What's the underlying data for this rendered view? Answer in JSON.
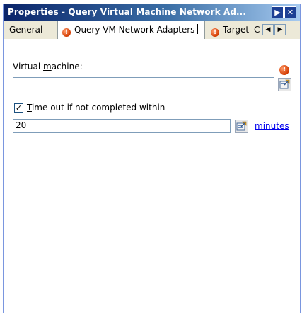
{
  "window": {
    "title": "Properties - Query Virtual Machine Network Ad..."
  },
  "titlebar_buttons": {
    "menu_glyph": "▶",
    "close_glyph": "✕"
  },
  "tabs": [
    {
      "label": "General",
      "active": false,
      "has_error": false
    },
    {
      "label": "Query VM Network Adapters",
      "active": true,
      "has_error": true
    },
    {
      "label": "Target",
      "active": false,
      "has_error": true
    },
    {
      "label": "C",
      "active": false,
      "has_error": false
    }
  ],
  "tab_scroll": {
    "left_glyph": "◀",
    "right_glyph": "▶"
  },
  "form": {
    "vm_label_prefix": "Virtual ",
    "vm_label_accel": "m",
    "vm_label_suffix": "achine:",
    "vm_value": "",
    "timeout_checked": true,
    "timeout_check_glyph": "✓",
    "timeout_label_accel": "T",
    "timeout_label_rest": "ime out if not completed within",
    "timeout_value": "20",
    "minutes_link": "minutes",
    "error_glyph": "!"
  },
  "colors": {
    "titlebar_start": "#0a246a",
    "titlebar_end": "#a6caf0",
    "error": "#d23b00",
    "link": "#0000ee"
  }
}
